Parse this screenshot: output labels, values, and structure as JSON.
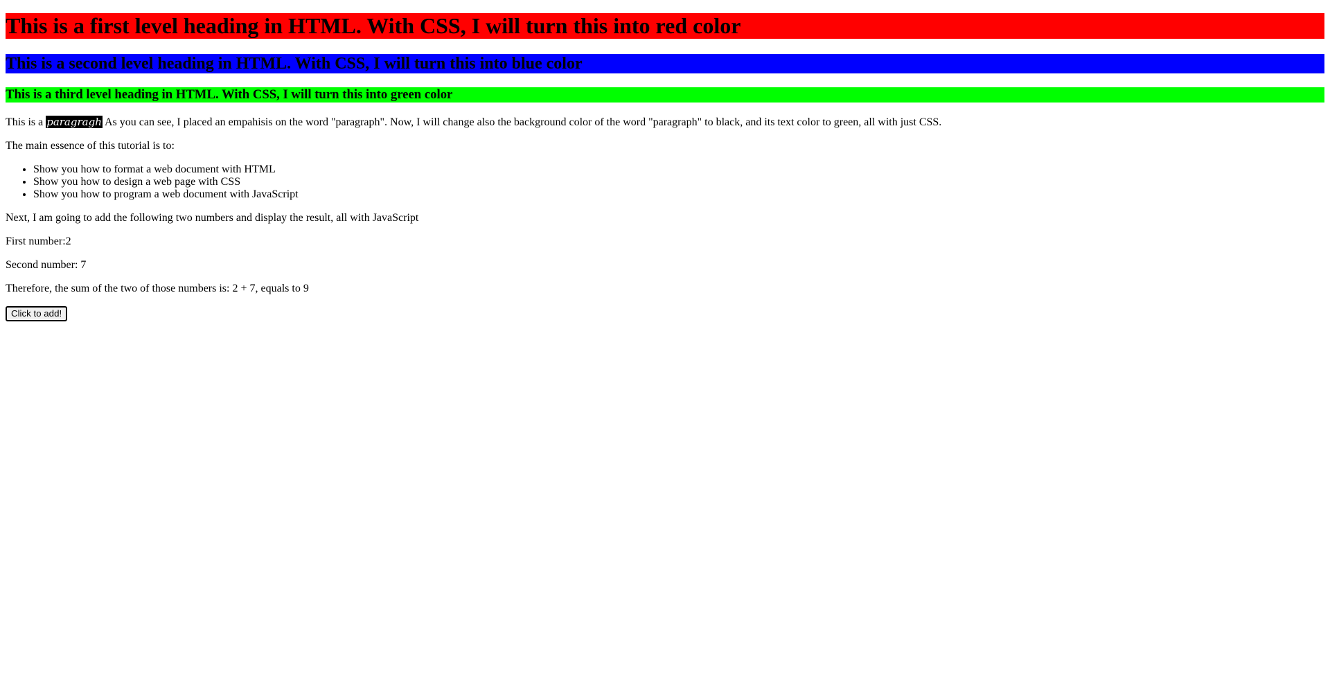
{
  "headings": {
    "h1": {
      "text": "This is a first level heading in HTML. With CSS, I will turn this into red color",
      "background": "#ff0000"
    },
    "h2": {
      "text": "This is a second level heading in HTML. With CSS, I will turn this into blue color",
      "background": "#0000ff"
    },
    "h3": {
      "text": "This is a third level heading in HTML. With CSS, I will turn this into green color",
      "background": "#00ff00"
    }
  },
  "intro": {
    "before": "This is a ",
    "emphasis": "paragragh",
    "after": " As you can see, I placed an empahisis on the word \"paragraph\". Now, I will change also the background color of the word \"paragraph\" to black, and its text color to green, all with just CSS.",
    "emphasis_background": "#000000",
    "emphasis_color": "#ffffff"
  },
  "essence_intro": "The main essence of this tutorial is to:",
  "essence_items": [
    "Show you how to format a web document with HTML",
    "Show you how to design a web page with CSS",
    "Show you how to program a web document with JavaScript"
  ],
  "addition": {
    "intro": "Next, I am going to add the following two numbers and display the result, all with JavaScript",
    "first": "First number:2",
    "second": "Second number: 7",
    "result": "Therefore, the sum of the two of those numbers is: 2 + 7, equals to 9",
    "button_label": "Click to add!"
  }
}
